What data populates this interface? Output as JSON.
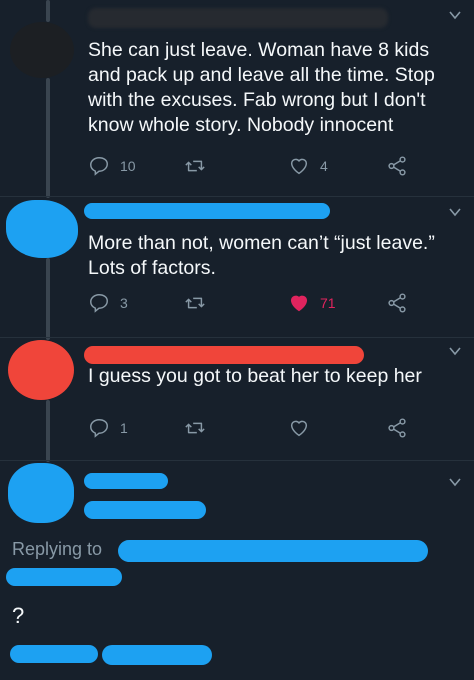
{
  "tweets": [
    {
      "text": "She can just leave. Woman have 8 kids and pack up and leave all the time. Stop with the excuses. Fab wrong but I don't know whole story. Nobody innocent",
      "replies": "10",
      "retweets": "",
      "likes": "4",
      "liked": false,
      "avatar_color": "#1c1f23",
      "redaction_color": "#1c1f23"
    },
    {
      "text": "More than not, women can’t “just leave.” Lots of factors.",
      "replies": "3",
      "retweets": "",
      "likes": "71",
      "liked": true,
      "avatar_color": "#1da1f2",
      "redaction_color": "#1da1f2"
    },
    {
      "text": "I guess you got to beat her to keep her",
      "replies": "1",
      "retweets": "",
      "likes": "",
      "liked": false,
      "avatar_color": "#f0453a",
      "redaction_color": "#f0453a"
    }
  ],
  "focused_reply": {
    "replying_to_label": "Replying to",
    "text": "?",
    "avatar_color": "#1da1f2",
    "redaction_color": "#1da1f2"
  },
  "colors": {
    "background": "#17202b",
    "muted": "#8899a6",
    "like_active": "#e0245e"
  },
  "icons": [
    "reply-icon",
    "retweet-icon",
    "like-icon",
    "share-icon",
    "chevron-down-icon"
  ]
}
